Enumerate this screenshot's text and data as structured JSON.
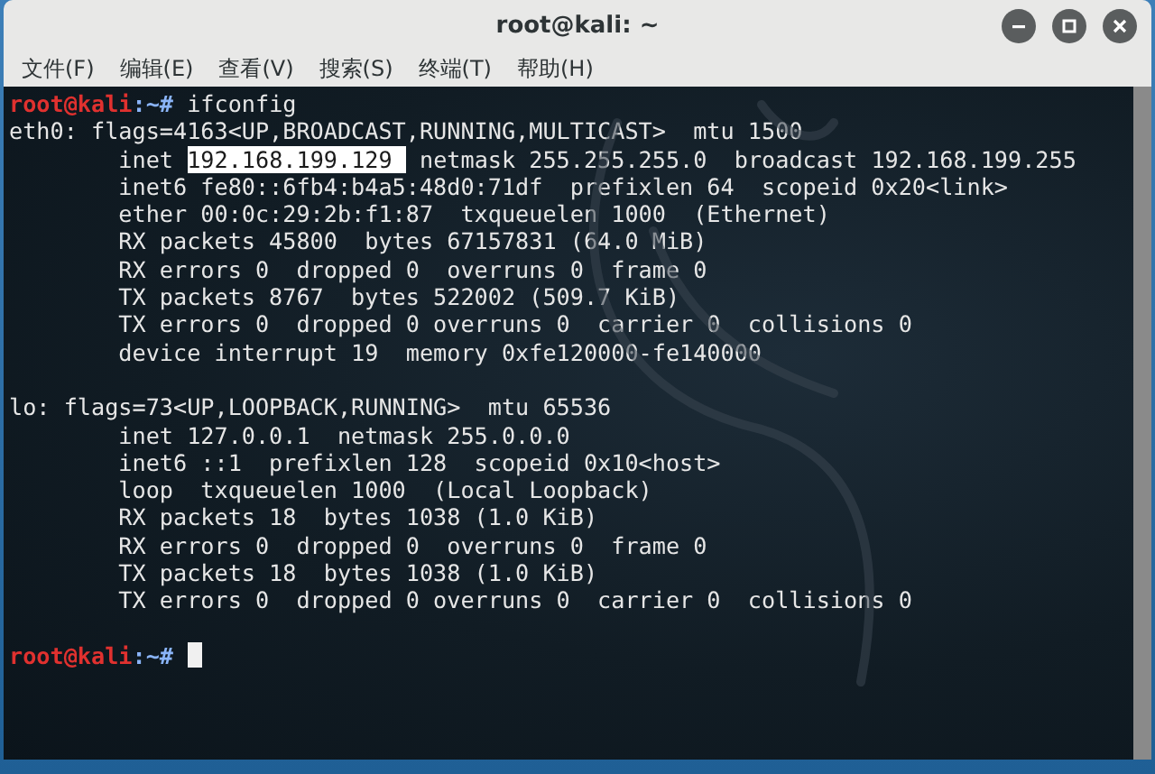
{
  "window": {
    "title": "root@kali: ~"
  },
  "menu": [
    {
      "label": "文件(F)"
    },
    {
      "label": "编辑(E)"
    },
    {
      "label": "查看(V)"
    },
    {
      "label": "搜索(S)"
    },
    {
      "label": "终端(T)"
    },
    {
      "label": "帮助(H)"
    }
  ],
  "terminal": {
    "lines": [
      {
        "kind": "prompt",
        "user_host": "root@kali",
        "path": ":~# ",
        "command": "ifconfig",
        "cursor": false
      },
      {
        "kind": "output",
        "text": "eth0: flags=4163<UP,BROADCAST,RUNNING,MULTICAST>  mtu 1500"
      },
      {
        "kind": "selection",
        "before": "        inet ",
        "selected": "192.168.199.129 ",
        "after": " netmask 255.255.255.0  broadcast 192.168.199.255"
      },
      {
        "kind": "output",
        "text": "        inet6 fe80::6fb4:b4a5:48d0:71df  prefixlen 64  scopeid 0x20<link>"
      },
      {
        "kind": "output",
        "text": "        ether 00:0c:29:2b:f1:87  txqueuelen 1000  (Ethernet)"
      },
      {
        "kind": "output",
        "text": "        RX packets 45800  bytes 67157831 (64.0 MiB)"
      },
      {
        "kind": "output",
        "text": "        RX errors 0  dropped 0  overruns 0  frame 0"
      },
      {
        "kind": "output",
        "text": "        TX packets 8767  bytes 522002 (509.7 KiB)"
      },
      {
        "kind": "output",
        "text": "        TX errors 0  dropped 0 overruns 0  carrier 0  collisions 0"
      },
      {
        "kind": "output",
        "text": "        device interrupt 19  memory 0xfe120000-fe140000"
      },
      {
        "kind": "blank"
      },
      {
        "kind": "output",
        "text": "lo: flags=73<UP,LOOPBACK,RUNNING>  mtu 65536"
      },
      {
        "kind": "output",
        "text": "        inet 127.0.0.1  netmask 255.0.0.0"
      },
      {
        "kind": "output",
        "text": "        inet6 ::1  prefixlen 128  scopeid 0x10<host>"
      },
      {
        "kind": "output",
        "text": "        loop  txqueuelen 1000  (Local Loopback)"
      },
      {
        "kind": "output",
        "text": "        RX packets 18  bytes 1038 (1.0 KiB)"
      },
      {
        "kind": "output",
        "text": "        RX errors 0  dropped 0  overruns 0  frame 0"
      },
      {
        "kind": "output",
        "text": "        TX packets 18  bytes 1038 (1.0 KiB)"
      },
      {
        "kind": "output",
        "text": "        TX errors 0  dropped 0 overruns 0  carrier 0  collisions 0"
      },
      {
        "kind": "blank"
      },
      {
        "kind": "prompt",
        "user_host": "root@kali",
        "path": ":~# ",
        "cursor": true
      }
    ]
  }
}
